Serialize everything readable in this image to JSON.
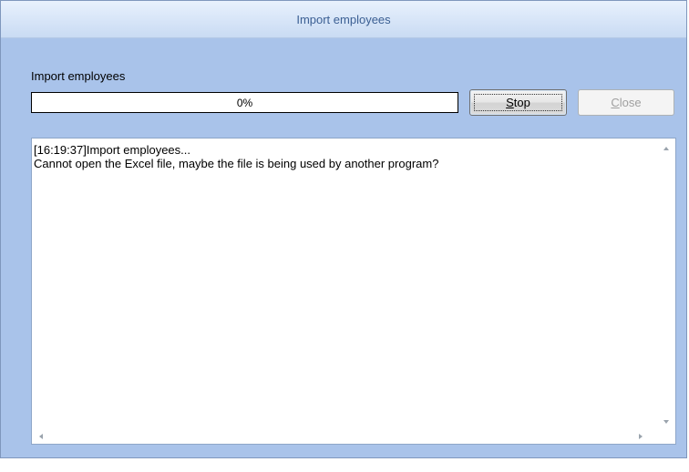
{
  "window": {
    "title": "Import employees"
  },
  "task": {
    "label": "Import employees",
    "progress_text": "0%",
    "progress_fraction": 0
  },
  "buttons": {
    "stop": {
      "mnemonic": "S",
      "rest": "top"
    },
    "close": {
      "mnemonic": "C",
      "rest": "lose",
      "enabled": false
    }
  },
  "log": {
    "lines": [
      "[16:19:37]Import employees...",
      "Cannot open the Excel file, maybe the file is being used by another program?"
    ]
  },
  "colors": {
    "dialog_bg": "#a9c3ea",
    "title_text": "#3b5f93",
    "disabled_text": "#a0a0a0"
  },
  "icons": {
    "scroll_up": "chevron-up-icon",
    "scroll_down": "chevron-down-icon",
    "scroll_left": "chevron-left-icon",
    "scroll_right": "chevron-right-icon"
  }
}
